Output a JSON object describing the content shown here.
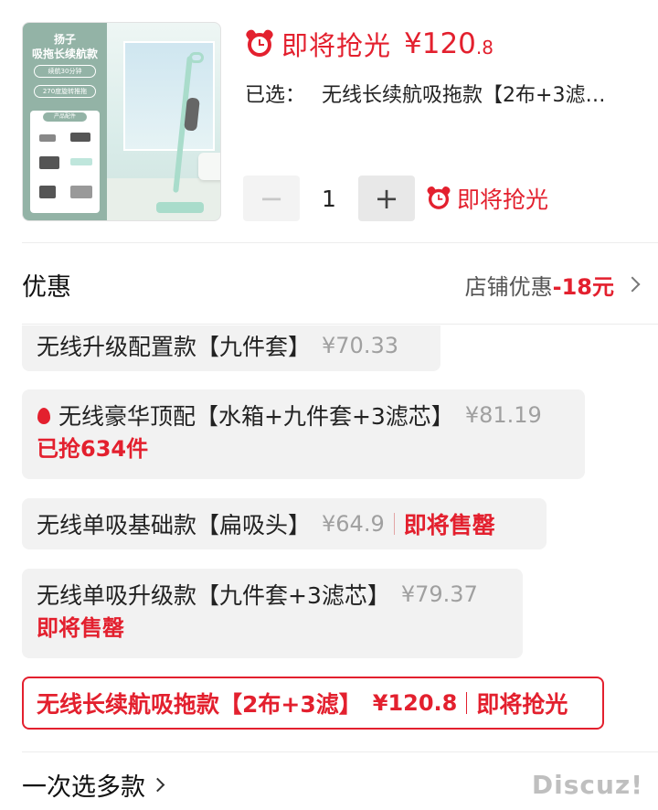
{
  "product": {
    "thumbnail": {
      "brand": "扬子",
      "model": "吸拖长续航款",
      "pill1": "续航30分钟",
      "pill2": "270度旋转推拖",
      "parts_title": "产品配件"
    },
    "promo_label": "即将抢光",
    "price_main": "¥120",
    "price_cents": ".8",
    "selected_label": "已选：",
    "selected_value": "无线长续航吸拖款【2布+3滤…",
    "quantity": "1",
    "stepper_note": "即将抢光"
  },
  "discount": {
    "title": "优惠",
    "shop_label": "店铺优惠",
    "amount": "-18元"
  },
  "options": [
    {
      "name": "无线升级配置款【九件套】",
      "price": "¥70.33"
    },
    {
      "name": "无线豪华顶配【水箱+九件套+3滤芯】",
      "price": "¥81.19",
      "status": "已抢634件"
    },
    {
      "name": "无线单吸基础款【扁吸头】",
      "price": "¥64.9",
      "status": "即将售罄"
    },
    {
      "name": "无线单吸升级款【九件套+3滤芯】",
      "price": "¥79.37",
      "status": "即将售罄"
    },
    {
      "name": "无线长续航吸拖款【2布+3滤】",
      "price": "¥120.8",
      "status": "即将抢光"
    }
  ],
  "footer": {
    "multi_select": "一次选多款",
    "watermark": "Discuz!"
  },
  "colors": {
    "accent": "#e3202e",
    "option_bg": "#f2f2f2"
  },
  "icons": {
    "alarm": "alarm-clock-icon",
    "flame": "flame-icon",
    "chevron": "chevron-right-icon"
  }
}
